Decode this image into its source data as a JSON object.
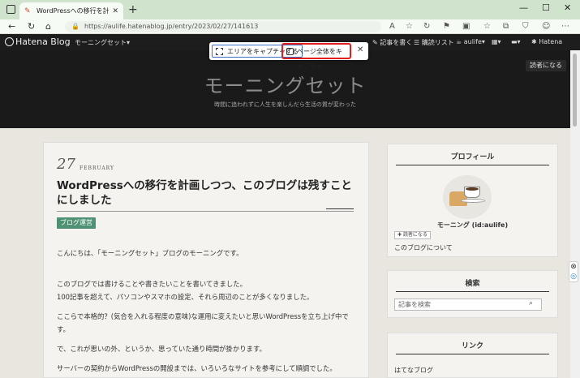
{
  "browser": {
    "tab_title": "WordPressへの移行を計画しつつ、こ",
    "tab_close": "✕",
    "new_tab": "+",
    "url": "https://aulife.hatenablog.jp/entry/2023/02/27/141613",
    "controls": {
      "minimize": "—",
      "maximize": "☐",
      "close": "✕"
    }
  },
  "hatena_bar": {
    "logo": "Hatena Blog",
    "blog_menu": "モーニングセット▾",
    "write": "記事を書く",
    "reading_list": "購読リスト",
    "user": "aulife▾",
    "brand": "Hatena"
  },
  "capture": {
    "area_label": "エリアをキャプチャする",
    "page_label": "ページ全体をキャプチャ",
    "close": "✕",
    "highlight_color": "#e21f1f"
  },
  "header": {
    "title": "モーニングセット",
    "description": "時間に追われずに人生を楽しんだら生活の質が変わった",
    "subscribe": "読者になる"
  },
  "article": {
    "day": "27",
    "month": "FEBRUARY",
    "title": "WordPressへの移行を計画しつつ、このブログは残すことにしました",
    "category": "ブログ運営",
    "paragraphs": [
      "こんにちは、「モーニングセット」ブログのモーニングです。",
      "このブログでは書けることや書きたいことを書いてきました。",
      "100記事を超えて、パソコンやスマホの設定、それら周辺のことが多くなりました。",
      "ここらで本格的？(気合を入れる程度の意味)な運用に変えたいと思いWordPressを立ち上げ中です。",
      "で、これが思いの外、というか、思っていた通り時間が掛かります。",
      "サーバーの契約からWordPressの開設までは、いろいろなサイトを参考にして順調でした。"
    ]
  },
  "sidebar": {
    "profile_heading": "プロフィール",
    "profile_name": "モーニング (id:aulife)",
    "follow": "✚ 読者になる",
    "about": "このブログについて",
    "search_heading": "検索",
    "search_placeholder": "記事を検索",
    "links_heading": "リンク",
    "link_item": "はてなブログ"
  }
}
